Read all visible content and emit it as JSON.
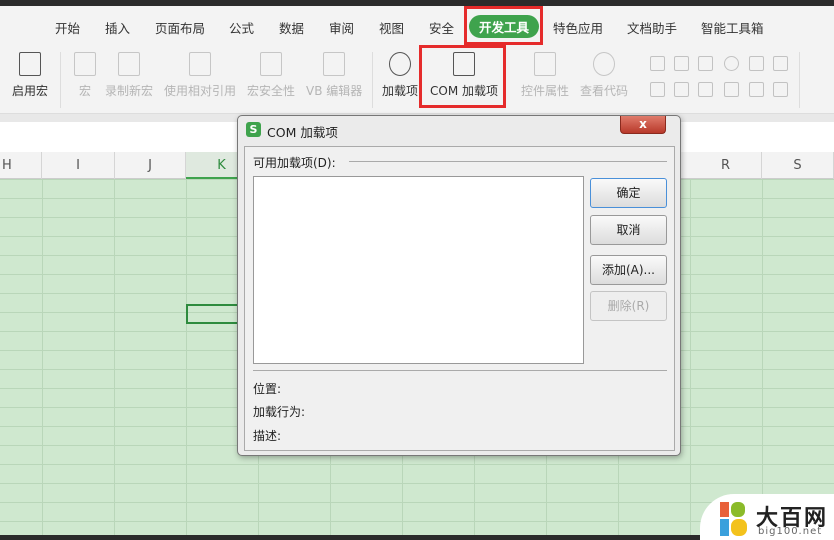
{
  "tabs": [
    "开始",
    "插入",
    "页面布局",
    "公式",
    "数据",
    "审阅",
    "视图",
    "安全",
    "开发工具",
    "特色应用",
    "文档助手",
    "智能工具箱"
  ],
  "active_tab": "开发工具",
  "ribbon": {
    "enable_macro": "启用宏",
    "macro": "宏",
    "record_macro": "录制新宏",
    "relative_ref": "使用相对引用",
    "macro_security": "宏安全性",
    "vb_editor": "VB 编辑器",
    "addins": "加载项",
    "com_addins": "COM 加载项",
    "control_props": "控件属性",
    "view_code": "查看代码"
  },
  "columns": [
    "H",
    "I",
    "J",
    "K",
    "R",
    "S"
  ],
  "dialog": {
    "title": "COM 加载项",
    "logo": "S",
    "close": "x",
    "available_label": "可用加载项(D):",
    "ok": "确定",
    "cancel": "取消",
    "add": "添加(A)...",
    "remove": "删除(R)",
    "location_label": "位置:",
    "load_behavior_label": "加载行为:",
    "description_label": "描述:"
  },
  "watermark": {
    "text": "大百网",
    "url": "big100.net"
  },
  "colors": {
    "accent": "#3fa34d",
    "highlight": "#e52b2b",
    "grid": "#cfe8cf"
  }
}
